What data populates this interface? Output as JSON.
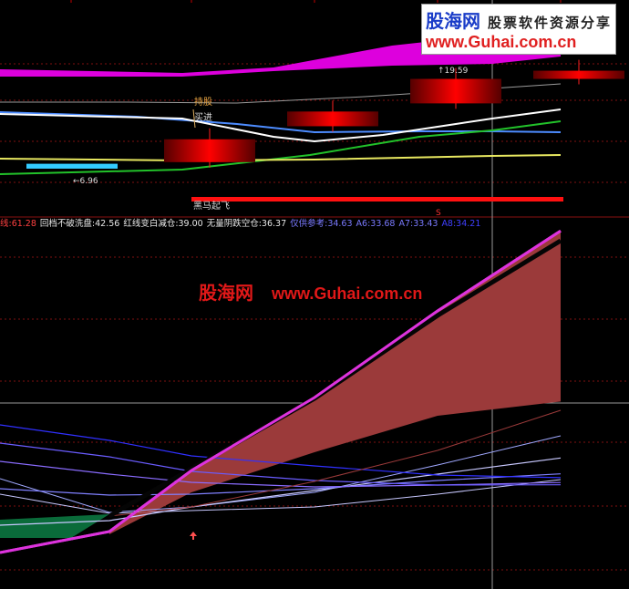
{
  "watermark": {
    "top_name": "股海网",
    "top_tag": "股票软件资源分享",
    "top_url": "www.Guhai.com.cn",
    "mid_name": "股海网",
    "mid_url": "www.Guhai.com.cn"
  },
  "upper_labels": {
    "chicang": "持股",
    "maijin": "买进",
    "low_value": "6.96",
    "high_value": "19.59",
    "heima": "黑马起飞",
    "s_marker": "S"
  },
  "indicator_line": [
    {
      "text": "线:61.28",
      "color": "#ff4040"
    },
    {
      "text": "回档不破洗盘:42.56",
      "color": "#e8e8e8"
    },
    {
      "text": "红线变白减仓:39.00",
      "color": "#e8e8e8"
    },
    {
      "text": "无量阴跌空仓:36.37",
      "color": "#e8e8e8"
    },
    {
      "text": "仅供参考:34.63",
      "color": "#7a7aff"
    },
    {
      "text": "A6:33.68",
      "color": "#7a7aff"
    },
    {
      "text": "A7:33.43",
      "color": "#7a7aff"
    },
    {
      "text": "A8:34.21",
      "color": "#4040ff"
    }
  ],
  "colors": {
    "background": "#000000",
    "magenta_band": "#dd00dd",
    "candle_red": "#ff0000",
    "cyan_bar": "#33ccff",
    "maroon_area": "#9b3a3a",
    "green_area": "#0a6b3a",
    "grid_red": "#801010"
  },
  "chart_data": {
    "type": "line",
    "panels": [
      "upper price panel",
      "lower indicator panel"
    ],
    "candles": [
      {
        "index": 0,
        "open": 8.2,
        "close": 7.6,
        "color": "cyan"
      },
      {
        "index": 1,
        "open": 11.2,
        "close": 8.4,
        "color": "red"
      },
      {
        "index": 2,
        "open": 14.6,
        "close": 12.8,
        "color": "red"
      },
      {
        "index": 3,
        "open": 18.6,
        "close": 15.6,
        "color": "red"
      },
      {
        "index": 4,
        "open": 19.6,
        "close": 18.6,
        "color": "red"
      }
    ],
    "lower_series": [
      {
        "name": "线",
        "values": [
          26.0,
          28.3,
          35.0,
          43.0,
          52.5,
          61.28
        ]
      },
      {
        "name": "回档不破洗盘",
        "values": [
          25.8,
          28.0,
          32.6,
          37.0,
          41.0,
          42.56
        ]
      },
      {
        "name": "红线变白减仓",
        "values": [
          25.8,
          28.1,
          31.2,
          34.5,
          37.3,
          39.0
        ]
      },
      {
        "name": "无量阴跌空仓",
        "values": [
          29.0,
          29.5,
          31.0,
          32.8,
          34.6,
          36.37
        ]
      },
      {
        "name": "仅供参考",
        "values": [
          33.0,
          32.3,
          32.4,
          33.0,
          33.9,
          34.63
        ]
      },
      {
        "name": "A6",
        "values": [
          36.0,
          34.6,
          33.7,
          33.2,
          33.4,
          33.68
        ]
      },
      {
        "name": "A7",
        "values": [
          38.0,
          36.5,
          34.9,
          33.9,
          33.4,
          33.43
        ]
      },
      {
        "name": "A8",
        "values": [
          40.0,
          38.3,
          36.6,
          35.5,
          34.5,
          34.21
        ]
      }
    ]
  }
}
